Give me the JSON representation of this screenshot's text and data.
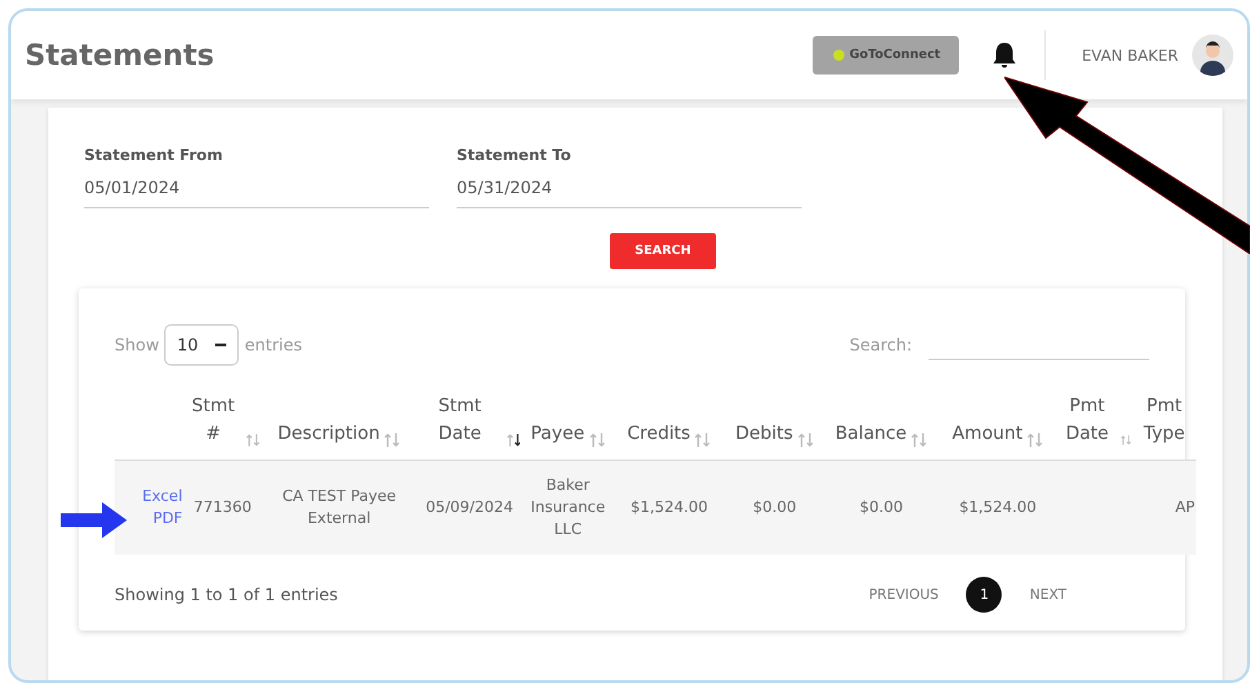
{
  "header": {
    "title": "Statements",
    "brand_button": "GoToConnect",
    "user_name": "EVAN BAKER"
  },
  "filters": [
    {
      "label": "Statement From",
      "value": "05/01/2024"
    },
    {
      "label": "Statement To",
      "value": "05/31/2024"
    }
  ],
  "search_button": "SEARCH",
  "table_controls": {
    "show_label": "Show",
    "page_size": "10",
    "entries_label": "entries",
    "search_label": "Search:"
  },
  "table": {
    "columns": [
      {
        "label": "Stmt #",
        "sorted_desc": false
      },
      {
        "label": "Description",
        "sorted_desc": false
      },
      {
        "label": "Stmt Date",
        "sorted_desc": true
      },
      {
        "label": "Payee",
        "sorted_desc": false
      },
      {
        "label": "Credits",
        "sorted_desc": false
      },
      {
        "label": "Debits",
        "sorted_desc": false
      },
      {
        "label": "Balance",
        "sorted_desc": false
      },
      {
        "label": "Amount",
        "sorted_desc": false
      },
      {
        "label": "Pmt Date",
        "sorted_desc": false
      },
      {
        "label": "Pmt Type"
      }
    ],
    "rows": [
      {
        "links": [
          "Excel",
          "PDF"
        ],
        "cells": [
          "771360",
          "CA TEST Payee External",
          "05/09/2024",
          "Baker Insurance LLC",
          "$1,524.00",
          "$0.00",
          "$0.00",
          "$1,524.00",
          "",
          "AP"
        ]
      }
    ]
  },
  "footer": {
    "info": "Showing 1 to 1 of 1 entries",
    "previous": "PREVIOUS",
    "pages": [
      {
        "label": "1",
        "selected": true
      }
    ],
    "next": "NEXT"
  }
}
